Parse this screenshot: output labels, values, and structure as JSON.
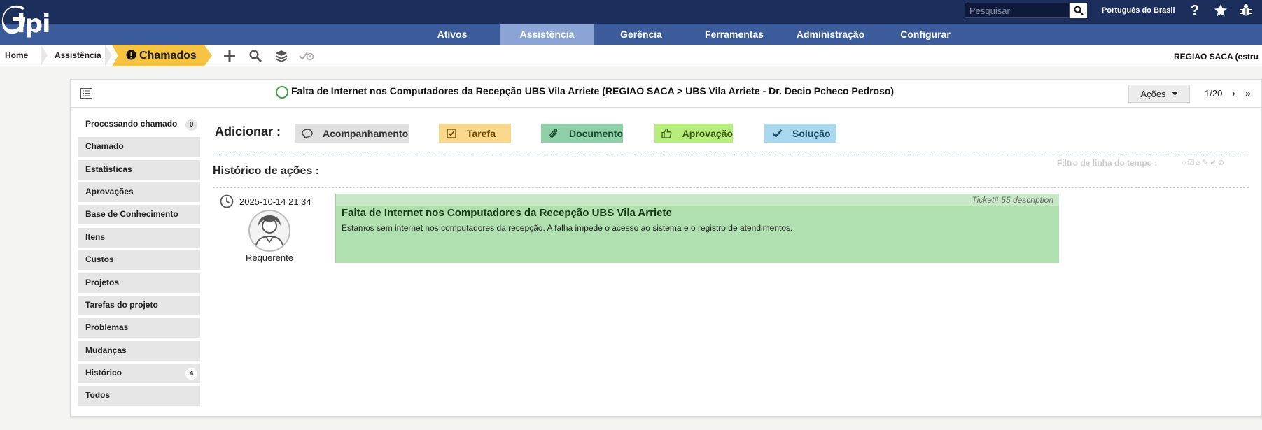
{
  "header": {
    "logo_text": "lpi",
    "search_placeholder": "Pesquisar",
    "language": "Português do Brasil",
    "icons": [
      "help-icon",
      "star-icon",
      "bug-icon"
    ]
  },
  "menu": {
    "items": [
      {
        "label": "Ativos",
        "active": false
      },
      {
        "label": "Assistência",
        "active": true
      },
      {
        "label": "Gerência",
        "active": false
      },
      {
        "label": "Ferramentas",
        "active": false
      },
      {
        "label": "Administração",
        "active": false
      },
      {
        "label": "Configurar",
        "active": false
      }
    ]
  },
  "breadcrumb": {
    "items": [
      "Home",
      "Assistência"
    ],
    "current": "Chamados",
    "tools": [
      "add-icon",
      "search-icon",
      "layers-icon",
      "check-time-icon"
    ],
    "entity": "REGIAO SACA (estru"
  },
  "ticket": {
    "title": "Falta de Internet nos Computadores da Recepção UBS Vila Arriete (REGIAO SACA > UBS Vila Arriete - Dr. Decio Pcheco Pedroso)",
    "actions_label": "Ações",
    "pager": "1/20",
    "status_color": "#3fa33f"
  },
  "tabs": [
    {
      "label": "Processando chamado",
      "count": "0",
      "active": true
    },
    {
      "label": "Chamado"
    },
    {
      "label": "Estatísticas"
    },
    {
      "label": "Aprovações"
    },
    {
      "label": "Base de Conhecimento"
    },
    {
      "label": "Itens"
    },
    {
      "label": "Custos"
    },
    {
      "label": "Projetos"
    },
    {
      "label": "Tarefas do projeto"
    },
    {
      "label": "Problemas"
    },
    {
      "label": "Mudanças"
    },
    {
      "label": "Histórico",
      "count": "4"
    },
    {
      "label": "Todos"
    }
  ],
  "add": {
    "label": "Adicionar :",
    "buttons": [
      {
        "label": "Acompanhamento",
        "icon": "comment-icon",
        "color": "#e0e0e0"
      },
      {
        "label": "Tarefa",
        "icon": "checkbox-icon",
        "color": "#fcd88c"
      },
      {
        "label": "Documento",
        "icon": "paperclip-icon",
        "color": "#8fd0a8"
      },
      {
        "label": "Aprovação",
        "icon": "thumbs-up-icon",
        "color": "#b6ee7e"
      },
      {
        "label": "Solução",
        "icon": "check-icon",
        "color": "#a9d8ee"
      }
    ]
  },
  "history": {
    "title": "Histórico de ações :",
    "filter_label": "Filtro de linha do tempo :"
  },
  "timeline": {
    "date": "2025-10-14 21:34",
    "role": "Requerente",
    "ticket_ref": "Ticket# 55 description",
    "title": "Falta de Internet nos Computadores da Recepção UBS Vila Arriete",
    "text": "Estamos sem internet nos computadores da recepção. A falha impede o acesso ao sistema e o registro de atendimentos."
  }
}
